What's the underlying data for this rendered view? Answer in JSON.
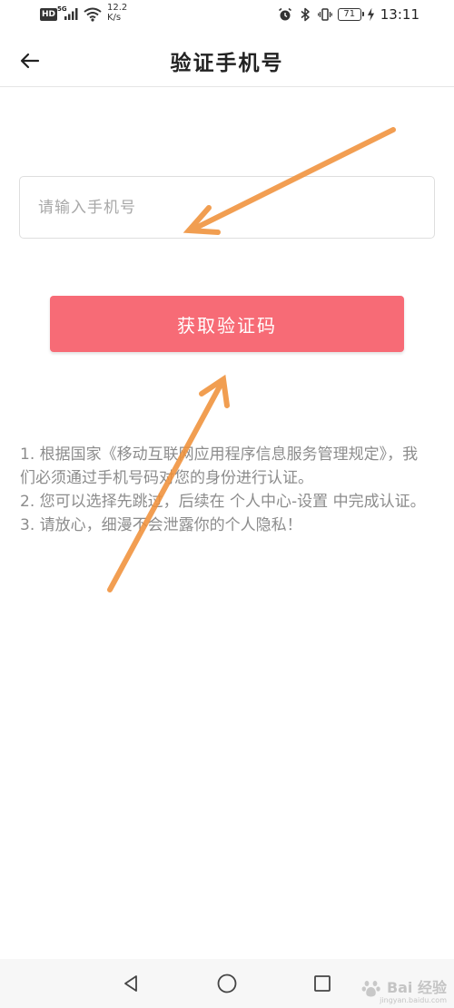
{
  "status_bar": {
    "hd": "HD",
    "network_type": "5G",
    "speed_value": "12.2",
    "speed_unit": "K/s",
    "battery": "71",
    "time": "13:11",
    "icons": [
      "signal-icon",
      "wifi-icon",
      "alarm-icon",
      "bluetooth-icon",
      "vibrate-icon",
      "battery-icon",
      "charging-icon"
    ]
  },
  "header": {
    "title": "验证手机号",
    "back_icon": "back-arrow-icon"
  },
  "phone_input": {
    "placeholder": "请输入手机号",
    "value": ""
  },
  "get_code_button": {
    "label": "获取验证码",
    "color": "#f76b76"
  },
  "notice": {
    "lines": [
      "1. 根据国家《移动互联网应用程序信息服务管理规定》，我们必须通过手机号码对您的身份进行认证。",
      "2. 您可以选择先跳过，后续在 个人中心-设置 中完成认证。",
      "3. 请放心，细漫不会泄露你的个人隐私！"
    ]
  },
  "annotation_arrows": {
    "color": "#f0913a"
  },
  "nav_bar": {
    "icons": [
      "back-triangle-icon",
      "home-circle-icon",
      "recents-square-icon"
    ]
  },
  "watermark": {
    "text": "Bai 经验",
    "sub": "jingyan.baidu.com"
  }
}
